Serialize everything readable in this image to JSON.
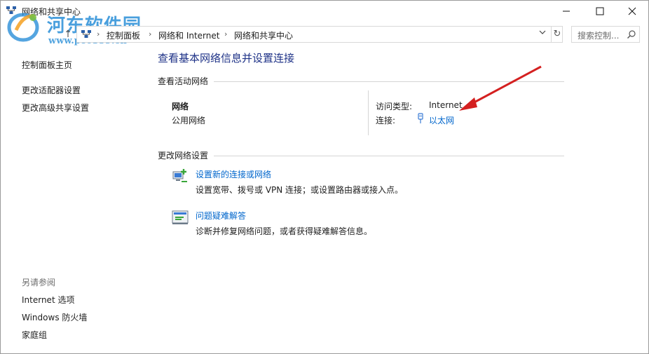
{
  "window": {
    "title": "网络和共享中心",
    "controls": {
      "minimize": "—",
      "maximize": "☐",
      "close": "✕"
    }
  },
  "watermark": {
    "name": "河东软件园",
    "url": "www.pc0359.cn"
  },
  "address_bar": {
    "breadcrumbs": [
      "控制面板",
      "网络和 Internet",
      "网络和共享中心"
    ],
    "separator": "›",
    "search_placeholder": "搜索控制..."
  },
  "left_pane": {
    "links": [
      "控制面板主页",
      "更改适配器设置",
      "更改高级共享设置"
    ],
    "see_also_header": "另请参阅",
    "see_also": [
      "Internet 选项",
      "Windows 防火墙",
      "家庭组"
    ]
  },
  "main": {
    "title": "查看基本网络信息并设置连接",
    "active_section": "查看活动网络",
    "network": {
      "name": "网络",
      "type": "公用网络",
      "access_label": "访问类型:",
      "access_value": "Internet",
      "connection_label": "连接:",
      "connection_value": "以太网"
    },
    "change_section": "更改网络设置",
    "tasks": [
      {
        "link": "设置新的连接或网络",
        "desc": "设置宽带、拨号或 VPN 连接；或设置路由器或接入点。"
      },
      {
        "link": "问题疑难解答",
        "desc": "诊断并修复网络问题，或者获得疑难解答信息。"
      }
    ]
  },
  "colors": {
    "link": "#0066cc",
    "title": "#1e3287",
    "annotation_arrow": "#d42020"
  }
}
